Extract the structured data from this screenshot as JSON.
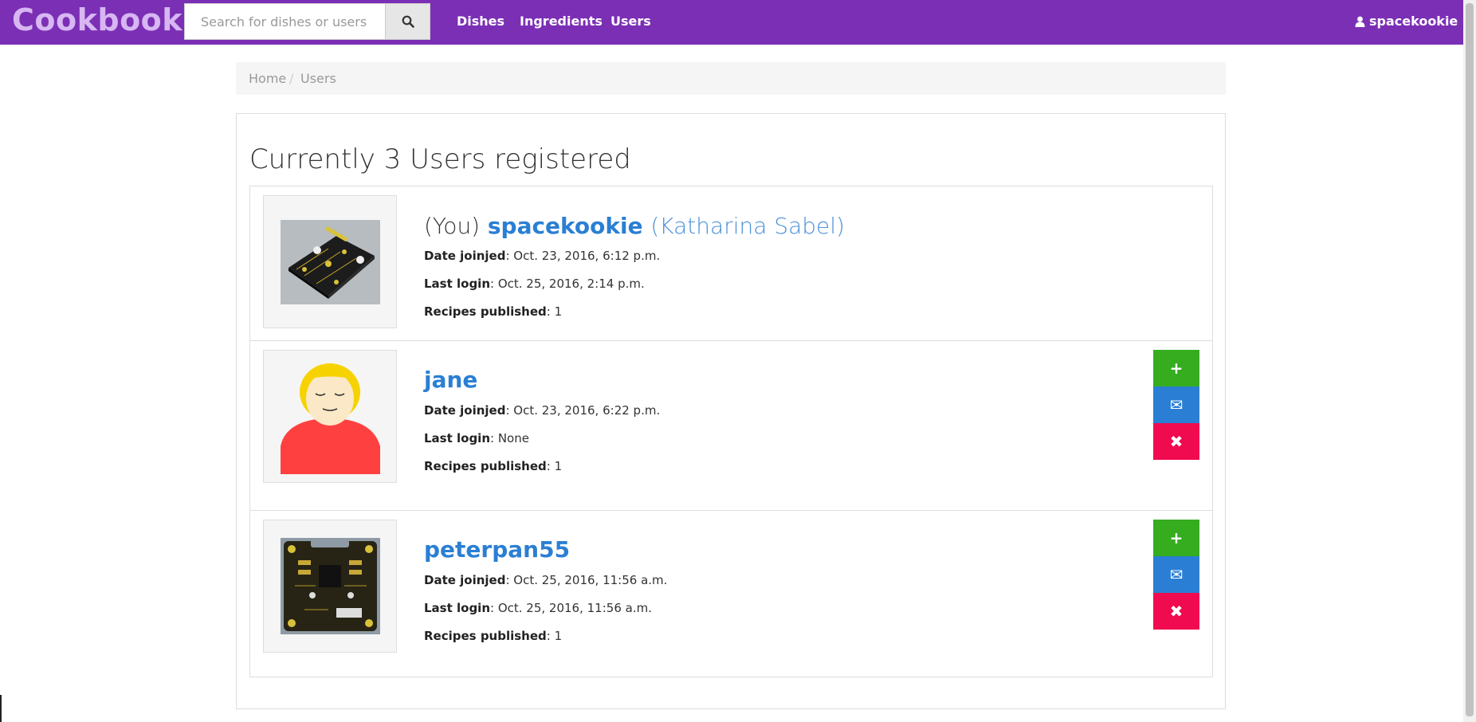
{
  "navbar": {
    "brand": "Cookbook",
    "search_placeholder": "Search for dishes or users",
    "links": [
      "Dishes",
      "Ingredients",
      "Users"
    ],
    "user": "spacekookie"
  },
  "breadcrumb": {
    "home": "Home",
    "separator": "/",
    "current": "Users"
  },
  "page_title": "Currently 3 Users registered",
  "labels": {
    "date_joined": "Date joinjed",
    "last_login": "Last login",
    "recipes_published": "Recipes published"
  },
  "users": [
    {
      "you_prefix": "(You)",
      "username": "spacekookie",
      "fullname": "(Katharina Sabel)",
      "date_joined": ": Oct. 23, 2016, 6:12 p.m.",
      "last_login": ": Oct. 25, 2016, 2:14 p.m.",
      "recipes_published": ": 1",
      "avatar": "circuit-board-yellow"
    },
    {
      "username": "jane",
      "date_joined": ": Oct. 23, 2016, 6:22 p.m.",
      "last_login": ": None",
      "recipes_published": ": 1",
      "avatar": "cartoon-girl"
    },
    {
      "username": "peterpan55",
      "date_joined": ": Oct. 25, 2016, 11:56 a.m.",
      "last_login": ": Oct. 25, 2016, 11:56 a.m.",
      "recipes_published": ": 1",
      "avatar": "circuit-board-dark"
    }
  ],
  "actions": {
    "add": "+",
    "message": "✉",
    "delete": "✖"
  },
  "colors": {
    "navbar": "#7b2fb5",
    "brand": "#d7b6f2",
    "link": "#2a7fd4",
    "add": "#35ad1f",
    "message": "#2a7fd4",
    "delete": "#f00a4f"
  }
}
